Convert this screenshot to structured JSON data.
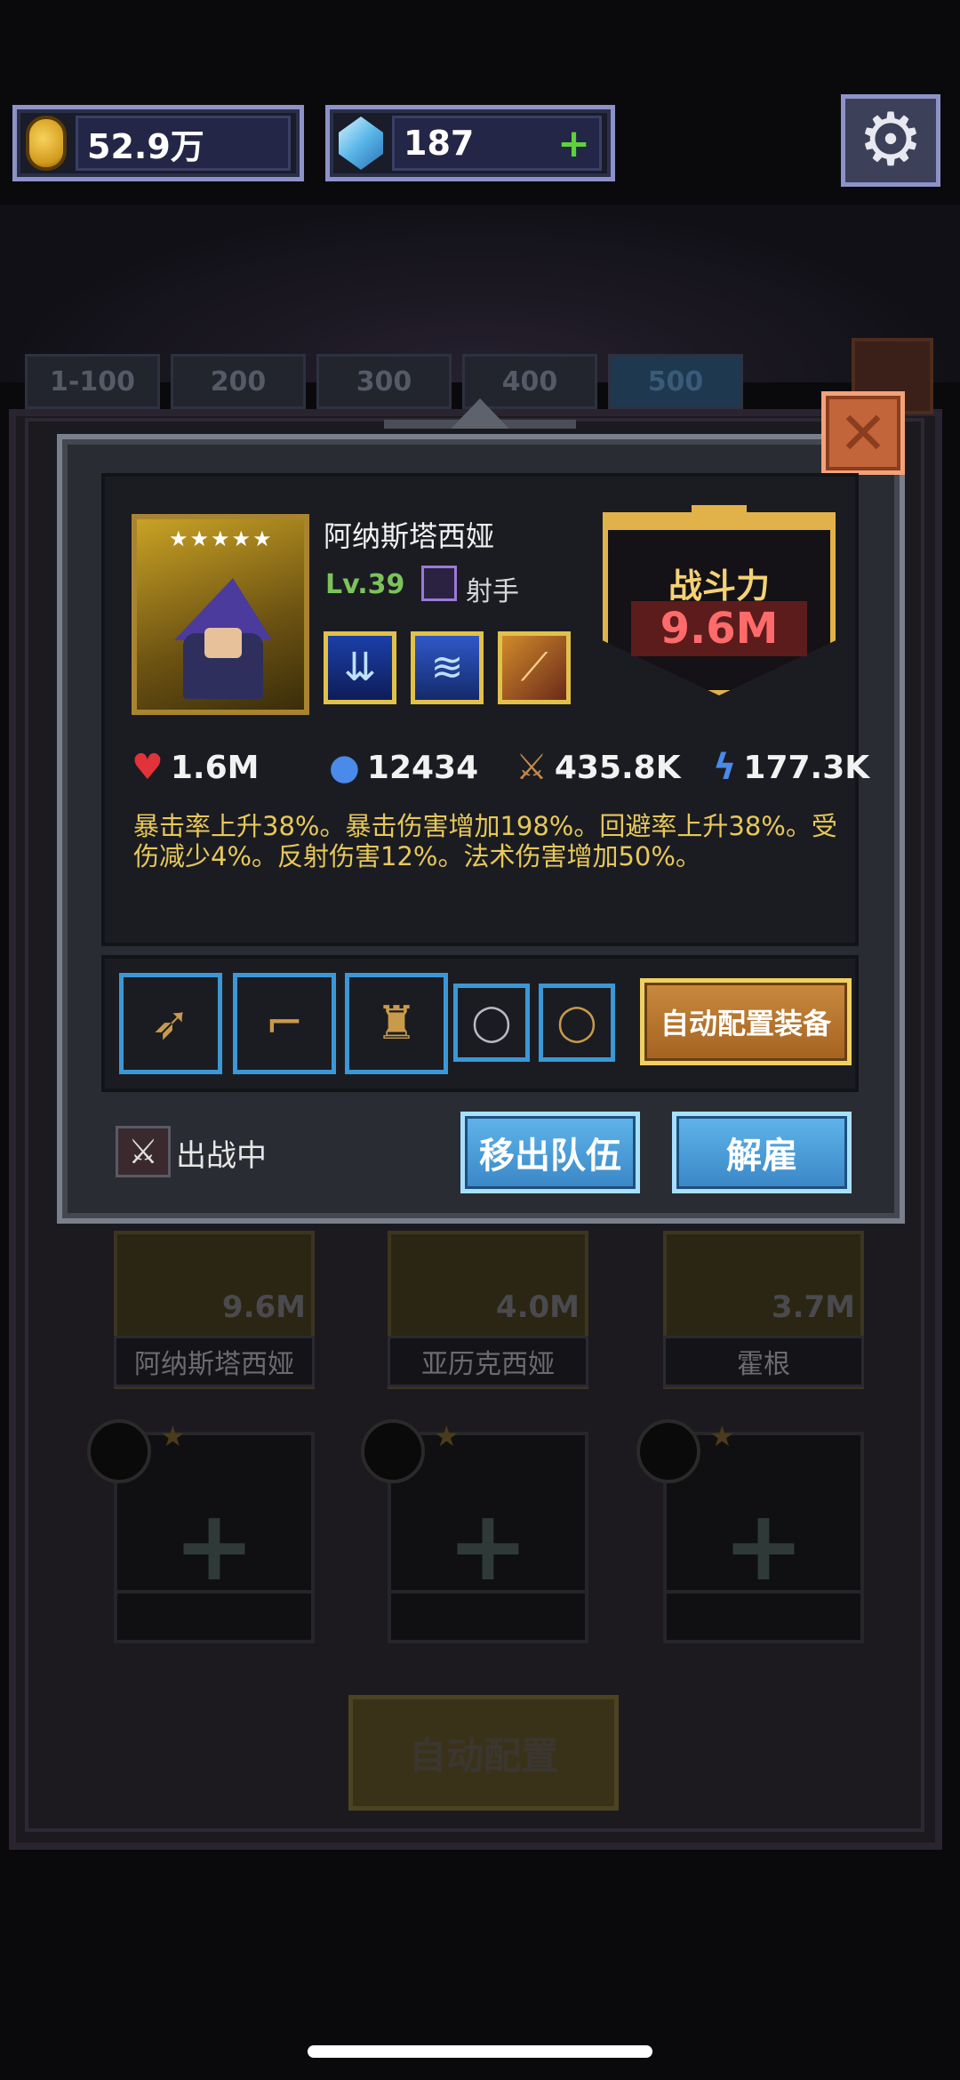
{
  "hud": {
    "gold_value": "52.9万",
    "gem_value": "187",
    "gem_add": "+"
  },
  "tabs": [
    "1-100",
    "200",
    "300",
    "400",
    "500"
  ],
  "hero": {
    "stars": "★★★★★",
    "name": "阿纳斯塔西娅",
    "level": "Lv.39",
    "class": "射手",
    "power_label": "战斗力",
    "power_value": "9.6M",
    "hp": "1.6M",
    "mp": "12434",
    "atk": "435.8K",
    "spd": "177.3K",
    "description": "暴击率上升38%。暴击伤害增加198%。回避率上升38%。受伤减少4%。反射伤害12%。法术伤害增加50%。"
  },
  "equipment": {
    "auto_equip_label": "自动配置装备"
  },
  "status": {
    "in_battle": "出战中"
  },
  "actions": {
    "remove_label": "移出队伍",
    "dismiss_label": "解雇"
  },
  "background_heroes": [
    {
      "name": "阿纳斯塔西娅",
      "power": "9.6M"
    },
    {
      "name": "亚历克西娅",
      "power": "4.0M"
    },
    {
      "name": "霍根",
      "power": "3.7M"
    }
  ],
  "background": {
    "auto_config_label": "自动配置"
  },
  "icons": {
    "gold": "gold-coin-icon",
    "gem": "gem-icon",
    "settings": "gear-icon",
    "close": "close-icon"
  },
  "colors": {
    "accent_gold": "#e2b24a",
    "button_blue": "#5fb5ea",
    "text_yellow": "#e7c85a"
  }
}
